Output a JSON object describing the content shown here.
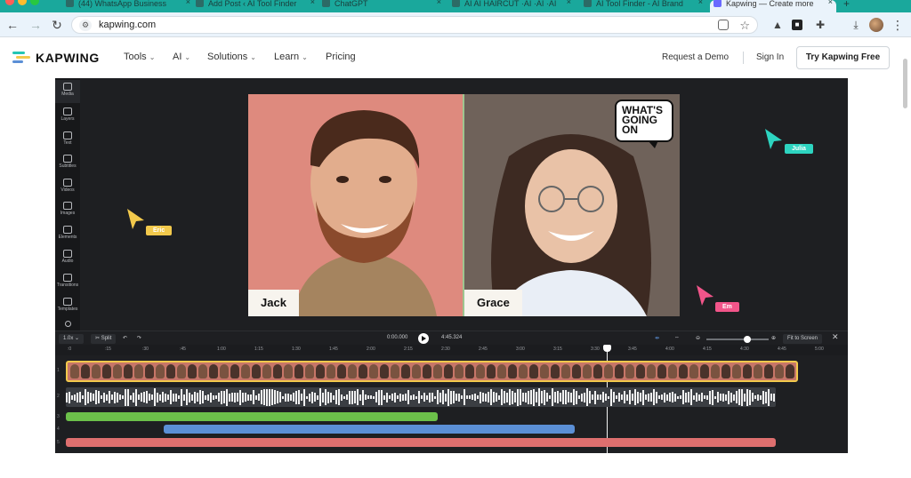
{
  "browser": {
    "tabs": [
      {
        "label": "(44) WhatsApp Business",
        "active": false
      },
      {
        "label": "Add Post ‹ AI Tool Finder",
        "active": false
      },
      {
        "label": "ChatGPT",
        "active": false
      },
      {
        "label": "AI AI HAIRCUT ·AI ·AI ·AI",
        "active": false
      },
      {
        "label": "AI Tool Finder - AI Brand",
        "active": false
      },
      {
        "label": "Kapwing — Create more",
        "active": true
      }
    ],
    "url": "kapwing.com"
  },
  "site": {
    "brand": "KAPWING",
    "nav": [
      {
        "label": "Tools",
        "dropdown": true
      },
      {
        "label": "AI",
        "dropdown": true
      },
      {
        "label": "Solutions",
        "dropdown": true
      },
      {
        "label": "Learn",
        "dropdown": true
      },
      {
        "label": "Pricing",
        "dropdown": false
      }
    ],
    "request_demo": "Request a Demo",
    "sign_in": "Sign In",
    "try_free": "Try Kapwing Free"
  },
  "editor": {
    "sidebar": [
      {
        "label": "Media",
        "icon": "media-icon"
      },
      {
        "label": "Layers",
        "icon": "layers-icon"
      },
      {
        "label": "Text",
        "icon": "text-icon"
      },
      {
        "label": "Subtitles",
        "icon": "subtitles-icon"
      },
      {
        "label": "Videos",
        "icon": "videos-icon"
      },
      {
        "label": "Images",
        "icon": "images-icon"
      },
      {
        "label": "Elements",
        "icon": "elements-icon"
      },
      {
        "label": "Audio",
        "icon": "audio-icon"
      },
      {
        "label": "Transitions",
        "icon": "transitions-icon"
      },
      {
        "label": "Templates",
        "icon": "templates-icon"
      }
    ],
    "canvas": {
      "left_name": "Jack",
      "right_name": "Grace",
      "bubble_text": "WHAT'S GOING ON"
    },
    "cursors": [
      {
        "name": "Eric",
        "color": "#f2c94c"
      },
      {
        "name": "Julia",
        "color": "#2dd4c0"
      },
      {
        "name": "Em",
        "color": "#f2558a"
      }
    ],
    "timeline": {
      "speed": "1.0x",
      "split": "Split",
      "current_time": "0:00.000",
      "total_time": "4:45.324",
      "fit_label": "Fit to Screen",
      "ticks": [
        ":0",
        ":15",
        ":30",
        ":45",
        "1:00",
        "1:15",
        "1:30",
        "1:45",
        "2:00",
        "2:15",
        "2:30",
        "2:45",
        "3:00",
        "3:15",
        "3:30",
        "3:45",
        "4:00",
        "4:15",
        "4:30",
        "4:45",
        "5:00"
      ],
      "track_numbers": [
        "1",
        "2",
        "3",
        "4",
        "5"
      ]
    }
  }
}
